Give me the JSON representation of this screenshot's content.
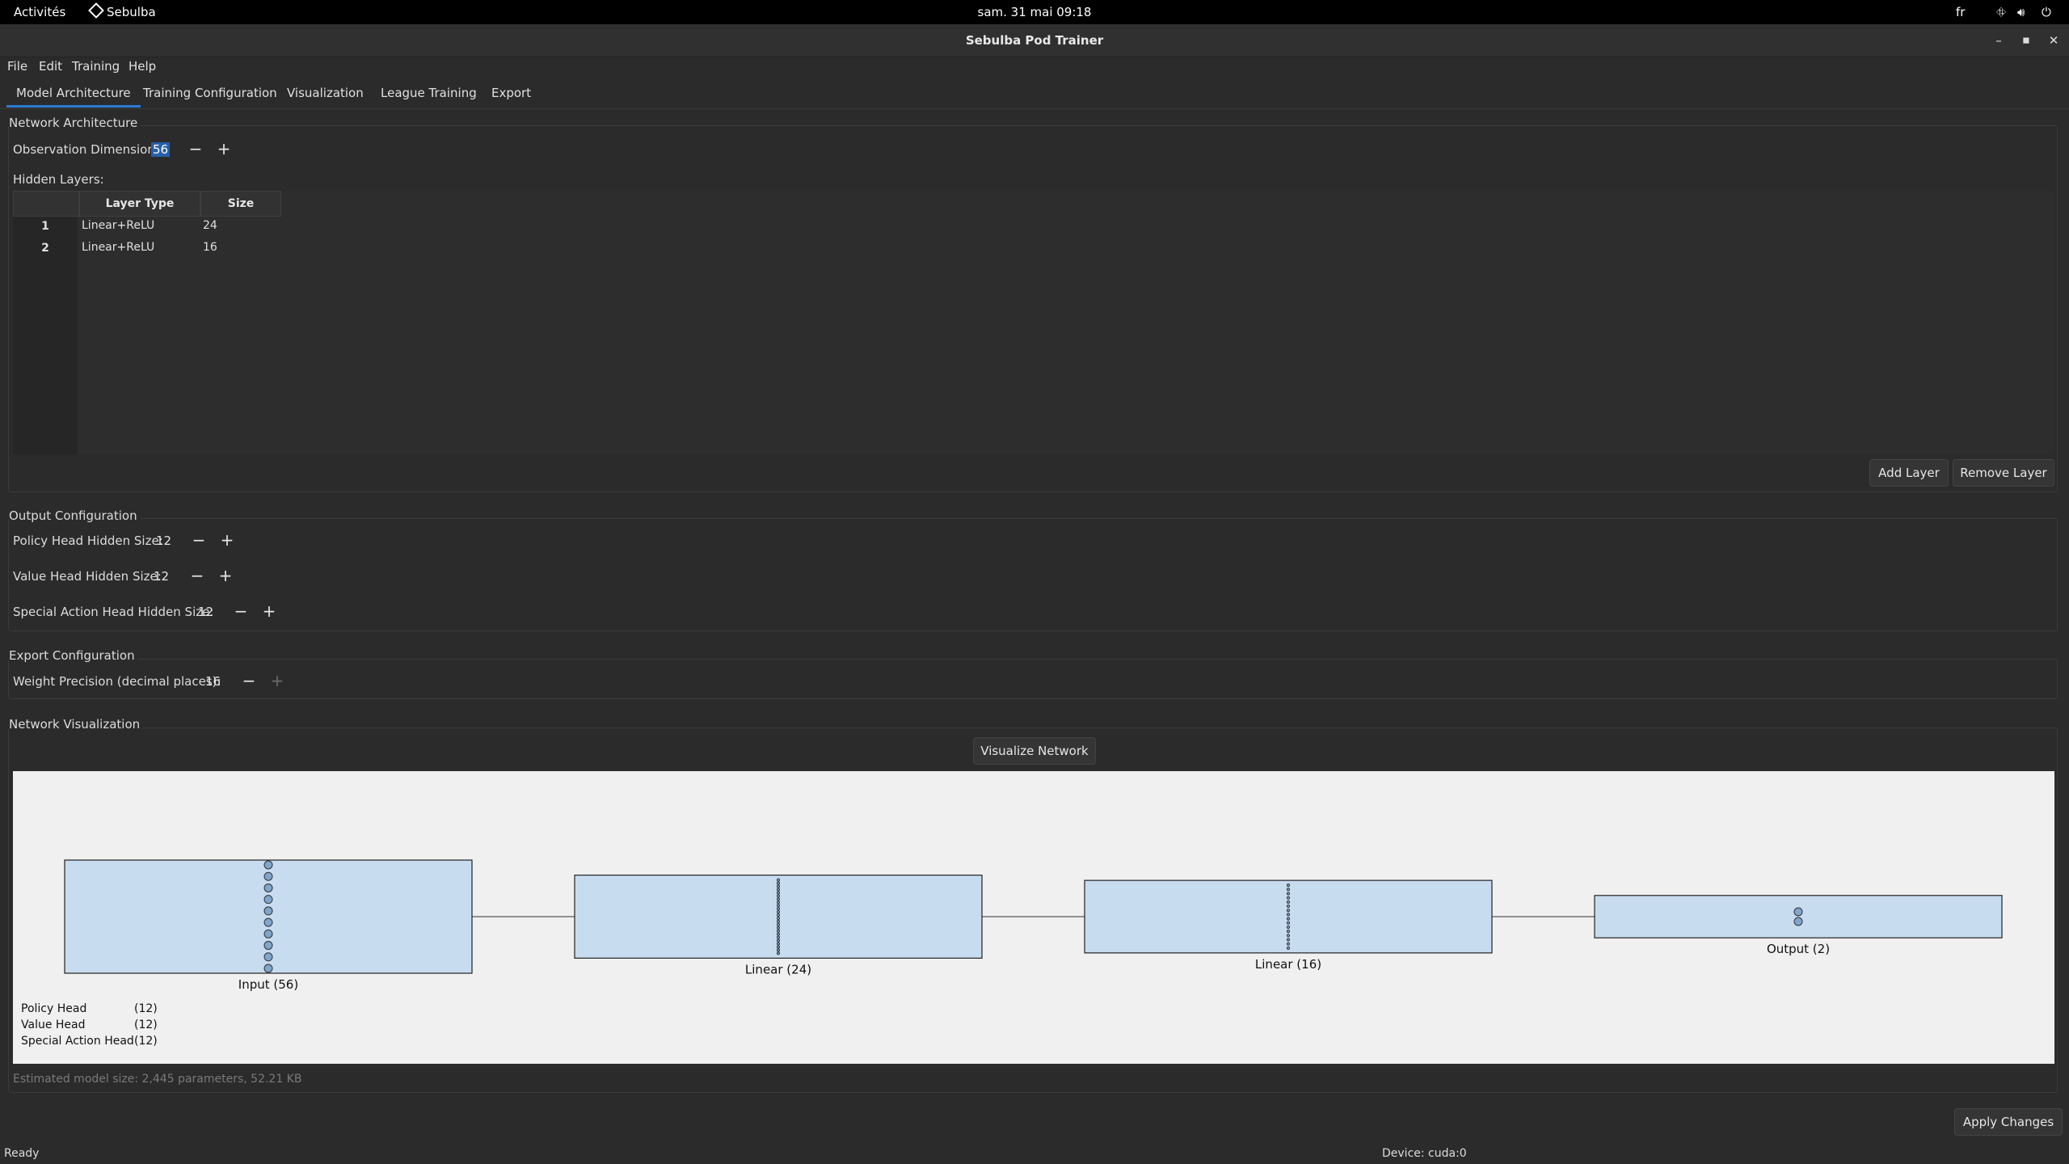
{
  "topbar": {
    "activities": "Activités",
    "app": "Sebulba",
    "clock": "sam. 31 mai  09:18",
    "lang": "fr"
  },
  "window": {
    "title": "Sebulba Pod Trainer"
  },
  "menu": [
    "File",
    "Edit",
    "Training",
    "Help"
  ],
  "tabs": [
    "Model Architecture",
    "Training Configuration",
    "Visualization",
    "League Training",
    "Export"
  ],
  "network_arch": {
    "title": "Network Architecture",
    "obs_label": "Observation Dimension:",
    "obs_value": "56",
    "hidden_label": "Hidden Layers:",
    "columns": [
      "Layer Type",
      "Size"
    ],
    "rows": [
      {
        "index": "1",
        "type": "Linear+ReLU",
        "size": "24"
      },
      {
        "index": "2",
        "type": "Linear+ReLU",
        "size": "16"
      }
    ],
    "add_layer": "Add Layer",
    "remove_layer": "Remove Layer"
  },
  "output_config": {
    "title": "Output Configuration",
    "policy_label": "Policy Head Hidden Size:",
    "policy_value": "12",
    "value_label": "Value Head Hidden Size:",
    "value_value": "12",
    "special_label": "Special Action Head Hidden Size:",
    "special_value": "12"
  },
  "export_config": {
    "title": "Export Configuration",
    "precision_label": "Weight Precision (decimal places):",
    "precision_value": "16"
  },
  "network_vis": {
    "title": "Network Visualization",
    "visualize_button": "Visualize Network",
    "layers": [
      {
        "label": "Input (56)",
        "neurons": 56
      },
      {
        "label": "Linear (24)",
        "neurons": 24
      },
      {
        "label": "Linear (16)",
        "neurons": 16
      },
      {
        "label": "Output (2)",
        "neurons": 2
      }
    ],
    "heads": [
      {
        "name": "Policy Head",
        "size": "(12)"
      },
      {
        "name": "Value Head",
        "size": "(12)"
      },
      {
        "name": "Special Action Head",
        "size": "(12)"
      }
    ]
  },
  "estimate": "Estimated model size: 2,445 parameters, 52.21 KB",
  "apply_button": "Apply Changes",
  "status": {
    "left": "Ready",
    "device": "Device: cuda:0"
  },
  "colors": {
    "accent": "#2a7bd4",
    "layer_fill": "#c8dcf0",
    "neuron_fill": "#7fa6cc"
  }
}
